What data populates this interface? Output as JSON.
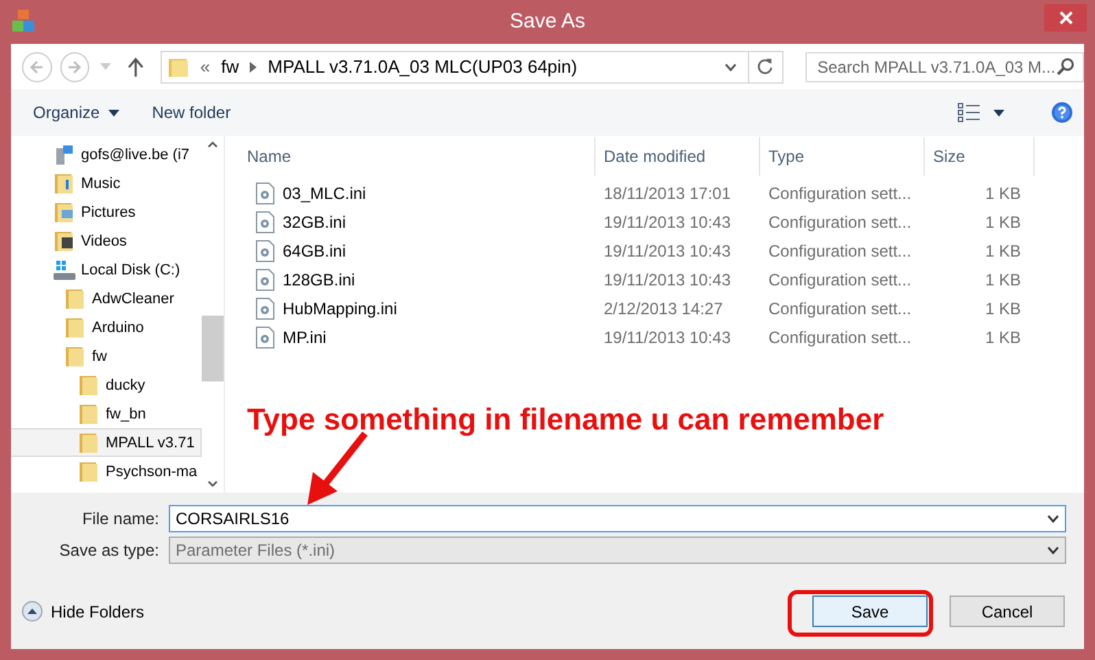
{
  "window": {
    "title": "Save As"
  },
  "nav": {
    "breadcrumb": [
      "«",
      "fw",
      "MPALL v3.71.0A_03 MLC(UP03 64pin)"
    ],
    "search": {
      "placeholder": "Search MPALL v3.71.0A_03 M..."
    }
  },
  "toolbar": {
    "organize": "Organize",
    "new_folder": "New folder"
  },
  "sidebar": {
    "items": [
      {
        "label": "gofs@live.be (i7",
        "kind": "network",
        "selected": false
      },
      {
        "label": "Music",
        "kind": "music",
        "selected": false
      },
      {
        "label": "Pictures",
        "kind": "pictures",
        "selected": false
      },
      {
        "label": "Videos",
        "kind": "videos",
        "selected": false
      },
      {
        "label": "Local Disk (C:)",
        "kind": "drive",
        "selected": false,
        "children": [
          {
            "label": "AdwCleaner",
            "kind": "folder",
            "selected": false
          },
          {
            "label": "Arduino",
            "kind": "folder",
            "selected": false
          },
          {
            "label": "fw",
            "kind": "folder",
            "selected": false,
            "children": [
              {
                "label": "ducky",
                "kind": "folder",
                "selected": false
              },
              {
                "label": "fw_bn",
                "kind": "folder",
                "selected": false
              },
              {
                "label": "MPALL v3.71",
                "kind": "folder",
                "selected": true
              },
              {
                "label": "Psychson-ma",
                "kind": "folder",
                "selected": false
              }
            ]
          }
        ]
      }
    ]
  },
  "table": {
    "columns": [
      "Name",
      "Date modified",
      "Type",
      "Size"
    ],
    "rows": [
      [
        "03_MLC.ini",
        "18/11/2013 17:01",
        "Configuration sett...",
        "1 KB"
      ],
      [
        "32GB.ini",
        "19/11/2013 10:43",
        "Configuration sett...",
        "1 KB"
      ],
      [
        "64GB.ini",
        "19/11/2013 10:43",
        "Configuration sett...",
        "1 KB"
      ],
      [
        "128GB.ini",
        "19/11/2013 10:43",
        "Configuration sett...",
        "1 KB"
      ],
      [
        "HubMapping.ini",
        "2/12/2013 14:27",
        "Configuration sett...",
        "1 KB"
      ],
      [
        "MP.ini",
        "19/11/2013 10:43",
        "Configuration sett...",
        "1 KB"
      ]
    ]
  },
  "annotation": {
    "text": "Type something in filename u can remember"
  },
  "form": {
    "file_name_label": "File name:",
    "file_name": "CORSAIRLS16",
    "type_label": "Save as type:",
    "type_value": "Parameter Files (*.ini)"
  },
  "footer": {
    "hide_folders": "Hide Folders",
    "save": "Save",
    "cancel": "Cancel"
  }
}
